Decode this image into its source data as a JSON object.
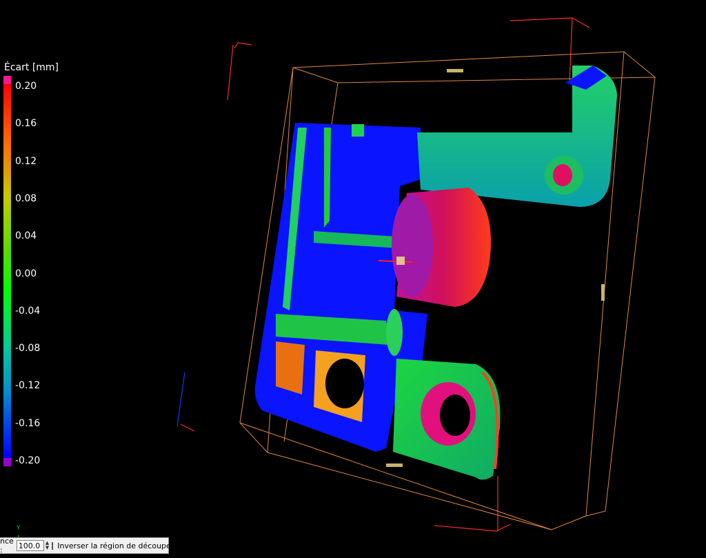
{
  "legend": {
    "title": "Écart [mm]",
    "ticks": [
      "0.20",
      "0.16",
      "0.12",
      "0.08",
      "0.04",
      "0.00",
      "-0.04",
      "-0.08",
      "-0.12",
      "-0.16",
      "-0.20"
    ],
    "over_color": "#ff1493",
    "under_color": "#9900cc",
    "gradient": [
      "#ff0000",
      "#ff6600",
      "#cccc00",
      "#66cc00",
      "#00ff00",
      "#00cc99",
      "#0099cc",
      "#0000ff"
    ]
  },
  "toolbar": {
    "tolerance_label": "nce :",
    "tolerance_value": "100.0",
    "invert_label": "Inverser la région de découpe"
  },
  "axis_label": "Y",
  "colors": {
    "part_base": "#0a14ff",
    "bbox": "#e08a3c",
    "corner_marks": "#ff2b2b"
  }
}
